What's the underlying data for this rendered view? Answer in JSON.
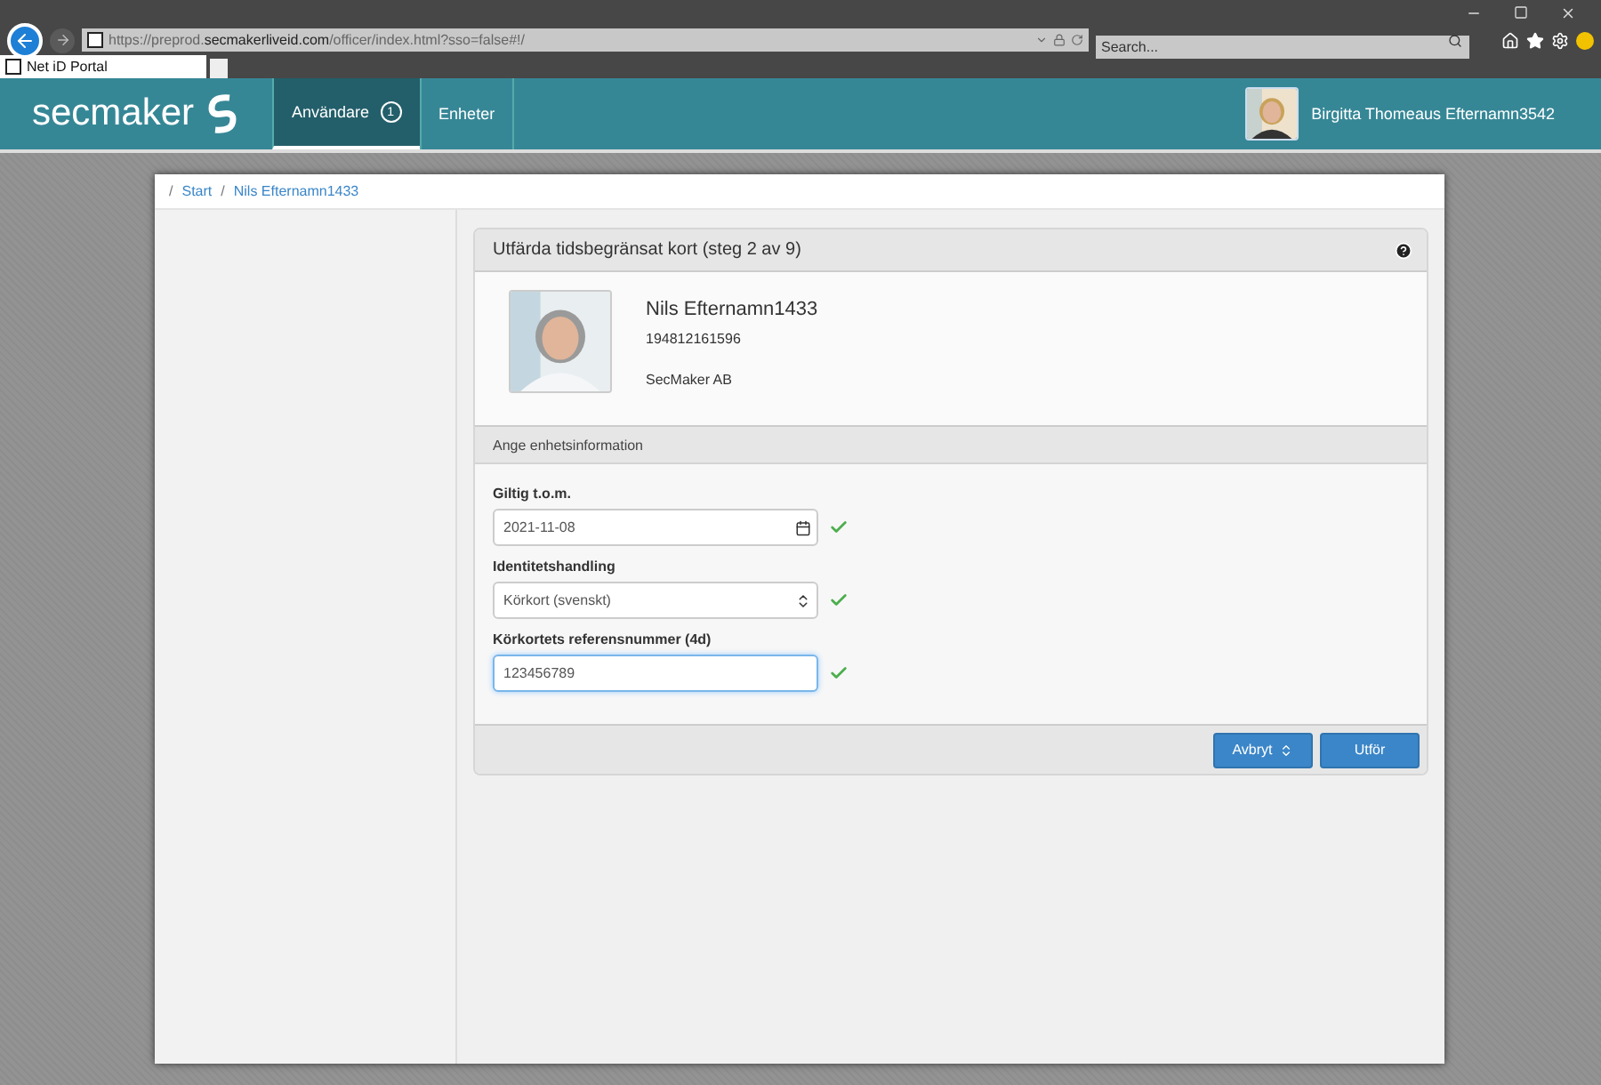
{
  "browser": {
    "url": "https://preprod.**secmakerliveid.com**/officer/index.html?sso=false#!/",
    "search": {
      "placeholder": "Search..."
    },
    "tabs": [
      {
        "label": "Net iD Portal",
        "selected": true
      }
    ]
  },
  "header": {
    "logo": "secmaker",
    "nav": [
      {
        "label": "Användare",
        "badge": "1",
        "selected": true
      },
      {
        "label": "Enheter",
        "selected": false
      }
    ],
    "user": "Birgitta Thomeaus Efternamn3542"
  },
  "breadcrumb": {
    "separator": "/",
    "items": [
      "Start",
      "Nils Efternamn1433"
    ]
  },
  "panel": {
    "title": "Utfärda tidsbegränsat kort (steg 2 av 9)",
    "person": {
      "name": "Nils Efternamn1433",
      "id_number": "194812161596",
      "organization": "SecMaker AB"
    },
    "section": "Ange enhetsinformation",
    "fields": [
      {
        "label": "Giltig t.o.m.",
        "value": "2021-11-08",
        "kind": "date",
        "valid": true,
        "focused": false
      },
      {
        "label": "Identitetshandling",
        "value": "Körkort (svenskt)",
        "kind": "select",
        "valid": true,
        "focused": false
      },
      {
        "label": "Körkortets referensnummer (4d)",
        "value": "123456789",
        "kind": "text",
        "valid": true,
        "focused": true
      }
    ],
    "buttons": [
      {
        "label": "Avbryt",
        "kind": "dropdown"
      },
      {
        "label": "Utför",
        "kind": "plain"
      }
    ]
  }
}
